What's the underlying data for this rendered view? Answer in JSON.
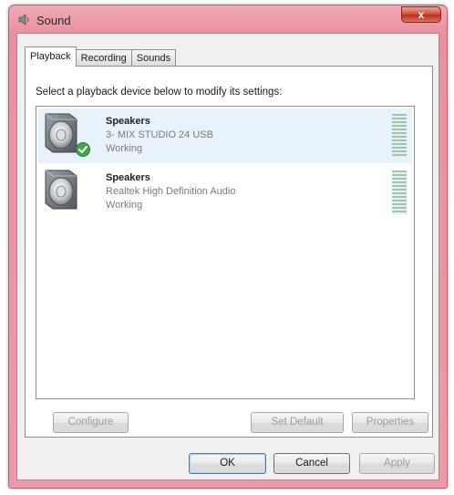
{
  "window": {
    "title": "Sound",
    "close_glyph": "x",
    "title_icon": "speaker-icon"
  },
  "tabs": [
    {
      "label": "Playback",
      "active": true
    },
    {
      "label": "Recording",
      "active": false
    },
    {
      "label": "Sounds",
      "active": false
    }
  ],
  "panel": {
    "instruction": "Select a playback device below to modify its settings:"
  },
  "devices": [
    {
      "name": "Speakers",
      "description": "3- MIX STUDIO 24 USB",
      "status": "Working",
      "selected": true,
      "is_default": true,
      "icon": "speaker-icon",
      "badge_icon": "checkmark-icon"
    },
    {
      "name": "Speakers",
      "description": "Realtek High Definition Audio",
      "status": "Working",
      "selected": false,
      "is_default": false,
      "icon": "speaker-icon"
    }
  ],
  "buttons": {
    "configure": "Configure",
    "set_default": "Set Default",
    "properties": "Properties",
    "ok": "OK",
    "cancel": "Cancel",
    "apply": "Apply"
  },
  "colors": {
    "title_bar": "#ec9aab",
    "close_button": "#c8432f",
    "selection": "#e8f2fb",
    "level_meter": "#9fc3b8"
  }
}
